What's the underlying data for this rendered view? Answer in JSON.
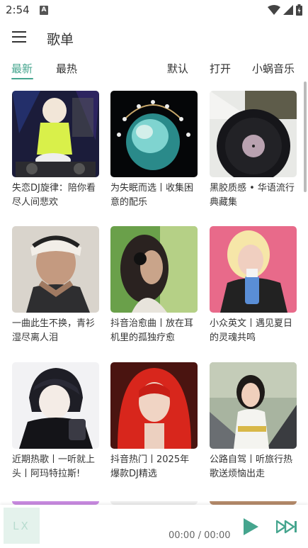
{
  "status_bar": {
    "time": "2:54",
    "notification_badge": "A"
  },
  "app_bar": {
    "title": "歌单"
  },
  "tabs": [
    {
      "label": "最新",
      "active": true
    },
    {
      "label": "最热",
      "active": false
    },
    {
      "label": "默认",
      "active": false
    },
    {
      "label": "打开",
      "active": false
    },
    {
      "label": "小蜗音乐",
      "active": false
    }
  ],
  "playlists": [
    {
      "title": "失恋DJ旋律：陪你看尽人间悲欢"
    },
    {
      "title": "为失眠而选丨收集困意的配乐"
    },
    {
      "title": "黑胶质感 • 华语流行典藏集"
    },
    {
      "title": "一曲此生不换，青衫湿尽离人泪"
    },
    {
      "title": "抖音治愈曲丨放在耳机里的孤独疗愈"
    },
    {
      "title": "小众英文丨遇见夏日的灵魂共鸣"
    },
    {
      "title": "近期热歌丨一听就上头丨阿玛特拉斯!"
    },
    {
      "title": "抖音热门丨2025年爆款DJ精选"
    },
    {
      "title": "公路自驾丨听旅行热歌送烦恼出走"
    }
  ],
  "player": {
    "logo_text": "LX",
    "time_display": "00:00 / 00:00",
    "accent": "#45a58e"
  }
}
